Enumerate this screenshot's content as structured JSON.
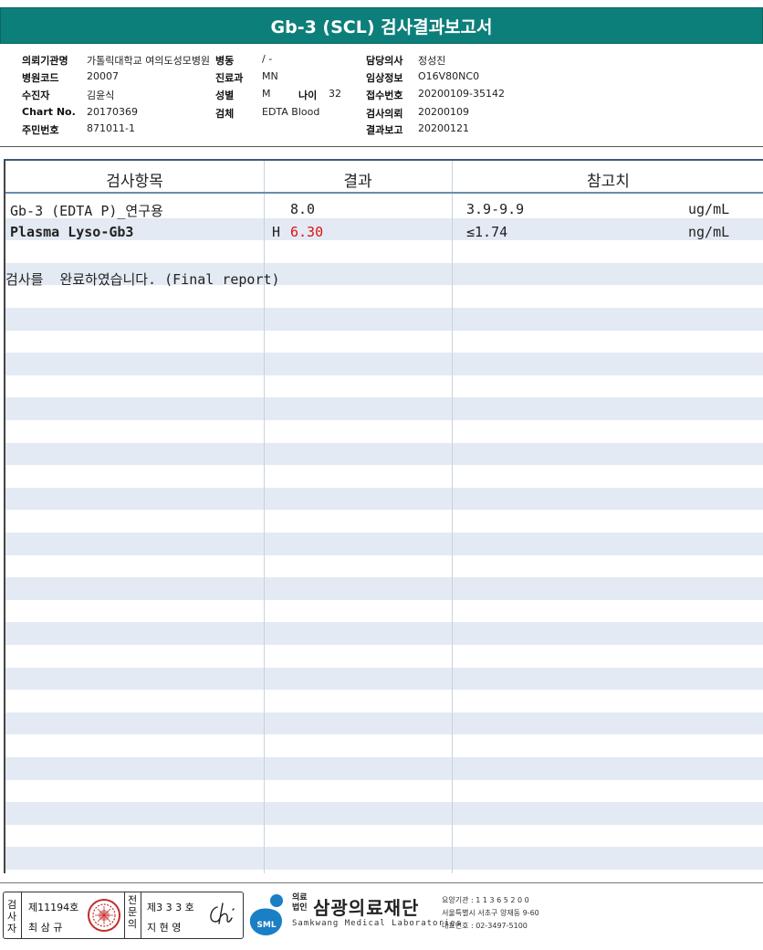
{
  "title": "Gb-3 (SCL) 검사결과보고서",
  "info": {
    "requesting_org_label": "의뢰기관명",
    "requesting_org_value": "가톨릭대학교 여의도성모병원",
    "ward_label": "병동",
    "ward_value": "/ -",
    "doctor_label": "담당의사",
    "doctor_value": "정성진",
    "hospital_code_label": "병원코드",
    "hospital_code_value": "20007",
    "department_label": "진료과",
    "department_value": "MN",
    "clinical_info_label": "임상정보",
    "clinical_info_value": "O16V80NC0",
    "patient_label": "수진자",
    "patient_value": "김윤식",
    "sex_label": "성별",
    "sex_value": "M",
    "age_label": "나이",
    "age_value": "32",
    "receipt_no_label": "접수번호",
    "receipt_no_value": "20200109-35142",
    "chart_no_label": "Chart No.",
    "chart_no_value": "20170369",
    "specimen_label": "검체",
    "specimen_value": "EDTA Blood",
    "request_date_label": "검사의뢰",
    "request_date_value": "20200109",
    "resident_no_label": "주민번호",
    "resident_no_value": "871011-1",
    "report_date_label": "결과보고",
    "report_date_value": "20200121"
  },
  "table": {
    "headers": [
      "검사항목",
      "결과",
      "참고치"
    ],
    "rows": [
      {
        "item": "Gb-3 (EDTA P)_연구용",
        "flag": "",
        "result": "8.0",
        "reference": "3.9-9.9",
        "unit": "ug/mL"
      },
      {
        "item": "Plasma Lyso-Gb3",
        "flag": "H",
        "result": "6.30",
        "reference": "≤1.74",
        "unit": "ng/mL"
      }
    ],
    "note": "검사를  완료하였습니다. (Final report)"
  },
  "signature": {
    "tester_label": "검사자",
    "tester_no": "제11194호",
    "tester_name": "최 삼 규",
    "specialist_label": "전문의",
    "specialist_no": "제3 3 3 호",
    "specialist_name": "지 현 영"
  },
  "org": {
    "logo_text": "SML",
    "prefix": "의료\n법인",
    "name": "삼광의료재단",
    "name_en": "Samkwang Medical Laboratories",
    "code": "요양기관 : 1 1 3 6 5 2 0 0",
    "address": "서울특별시 서초구 양재동 9-60",
    "phone": "대표번호 : 02-3497-5100"
  },
  "colors": {
    "title_bg": "#0d7f7a",
    "row_alt": "#e3eaf3",
    "high_flag": "#e01010",
    "logo_blue": "#1a7fc4"
  }
}
